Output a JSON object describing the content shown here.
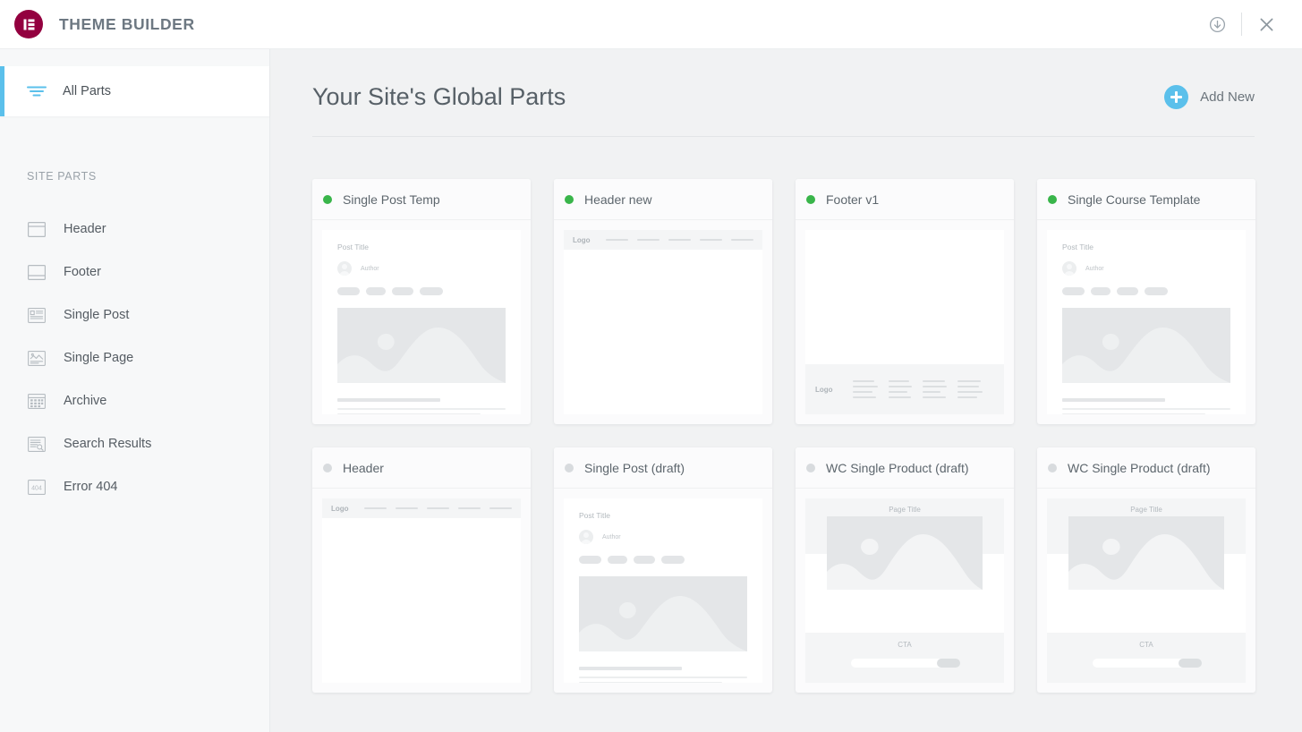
{
  "app": {
    "title": "THEME BUILDER",
    "logo_icon": "elementor-logo-icon",
    "logo_color": "#93003f",
    "accent_color": "#5bc0eb",
    "published_color": "#39b54a",
    "draft_color": "#d8dbde"
  },
  "topbar": {
    "save_icon": "circle-arrow-down-icon",
    "close_icon": "close-icon"
  },
  "sidebar": {
    "all_parts": {
      "label": "All Parts",
      "icon": "filter-lines-icon",
      "active": true
    },
    "section_heading": "SITE PARTS",
    "items": [
      {
        "label": "Header",
        "icon": "header-layout-icon"
      },
      {
        "label": "Footer",
        "icon": "footer-layout-icon"
      },
      {
        "label": "Single Post",
        "icon": "single-post-icon"
      },
      {
        "label": "Single Page",
        "icon": "single-page-icon"
      },
      {
        "label": "Archive",
        "icon": "archive-grid-icon"
      },
      {
        "label": "Search Results",
        "icon": "search-results-icon"
      },
      {
        "label": "Error 404",
        "icon": "error-404-icon"
      }
    ]
  },
  "main": {
    "page_title": "Your Site's Global Parts",
    "add_new": {
      "label": "Add New",
      "icon": "plus-circle-icon"
    }
  },
  "cards": [
    {
      "title": "Single Post Temp",
      "status": "published",
      "thumb": "post"
    },
    {
      "title": "Header new",
      "status": "published",
      "thumb": "header"
    },
    {
      "title": "Footer v1",
      "status": "published",
      "thumb": "footer"
    },
    {
      "title": "Single Course Template",
      "status": "published",
      "thumb": "post"
    },
    {
      "title": "Header",
      "status": "draft",
      "thumb": "header"
    },
    {
      "title": "Single Post (draft)",
      "status": "draft",
      "thumb": "post"
    },
    {
      "title": "WC Single Product (draft)",
      "status": "draft",
      "thumb": "product"
    },
    {
      "title": "WC Single Product (draft)",
      "status": "draft",
      "thumb": "product"
    }
  ],
  "thumb_text": {
    "post_title": "Post Title",
    "author": "Author",
    "logo": "Logo",
    "page_title": "Page Title",
    "cta": "CTA"
  }
}
